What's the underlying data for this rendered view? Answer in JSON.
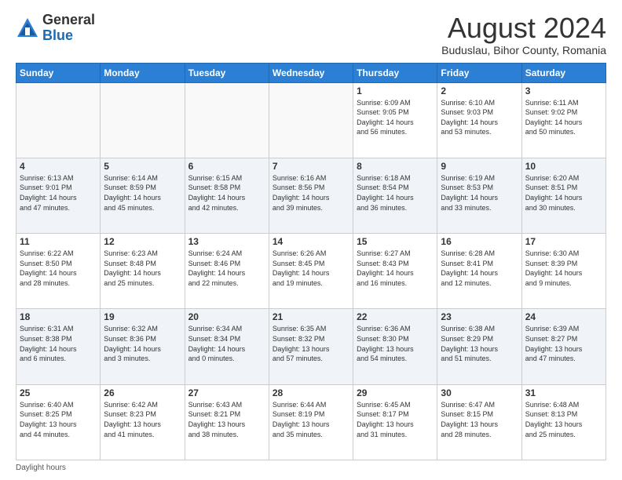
{
  "header": {
    "logo_general": "General",
    "logo_blue": "Blue",
    "main_title": "August 2024",
    "subtitle": "Buduslau, Bihor County, Romania"
  },
  "weekdays": [
    "Sunday",
    "Monday",
    "Tuesday",
    "Wednesday",
    "Thursday",
    "Friday",
    "Saturday"
  ],
  "weeks": [
    [
      {
        "day": "",
        "info": ""
      },
      {
        "day": "",
        "info": ""
      },
      {
        "day": "",
        "info": ""
      },
      {
        "day": "",
        "info": ""
      },
      {
        "day": "1",
        "info": "Sunrise: 6:09 AM\nSunset: 9:05 PM\nDaylight: 14 hours\nand 56 minutes."
      },
      {
        "day": "2",
        "info": "Sunrise: 6:10 AM\nSunset: 9:03 PM\nDaylight: 14 hours\nand 53 minutes."
      },
      {
        "day": "3",
        "info": "Sunrise: 6:11 AM\nSunset: 9:02 PM\nDaylight: 14 hours\nand 50 minutes."
      }
    ],
    [
      {
        "day": "4",
        "info": "Sunrise: 6:13 AM\nSunset: 9:01 PM\nDaylight: 14 hours\nand 47 minutes."
      },
      {
        "day": "5",
        "info": "Sunrise: 6:14 AM\nSunset: 8:59 PM\nDaylight: 14 hours\nand 45 minutes."
      },
      {
        "day": "6",
        "info": "Sunrise: 6:15 AM\nSunset: 8:58 PM\nDaylight: 14 hours\nand 42 minutes."
      },
      {
        "day": "7",
        "info": "Sunrise: 6:16 AM\nSunset: 8:56 PM\nDaylight: 14 hours\nand 39 minutes."
      },
      {
        "day": "8",
        "info": "Sunrise: 6:18 AM\nSunset: 8:54 PM\nDaylight: 14 hours\nand 36 minutes."
      },
      {
        "day": "9",
        "info": "Sunrise: 6:19 AM\nSunset: 8:53 PM\nDaylight: 14 hours\nand 33 minutes."
      },
      {
        "day": "10",
        "info": "Sunrise: 6:20 AM\nSunset: 8:51 PM\nDaylight: 14 hours\nand 30 minutes."
      }
    ],
    [
      {
        "day": "11",
        "info": "Sunrise: 6:22 AM\nSunset: 8:50 PM\nDaylight: 14 hours\nand 28 minutes."
      },
      {
        "day": "12",
        "info": "Sunrise: 6:23 AM\nSunset: 8:48 PM\nDaylight: 14 hours\nand 25 minutes."
      },
      {
        "day": "13",
        "info": "Sunrise: 6:24 AM\nSunset: 8:46 PM\nDaylight: 14 hours\nand 22 minutes."
      },
      {
        "day": "14",
        "info": "Sunrise: 6:26 AM\nSunset: 8:45 PM\nDaylight: 14 hours\nand 19 minutes."
      },
      {
        "day": "15",
        "info": "Sunrise: 6:27 AM\nSunset: 8:43 PM\nDaylight: 14 hours\nand 16 minutes."
      },
      {
        "day": "16",
        "info": "Sunrise: 6:28 AM\nSunset: 8:41 PM\nDaylight: 14 hours\nand 12 minutes."
      },
      {
        "day": "17",
        "info": "Sunrise: 6:30 AM\nSunset: 8:39 PM\nDaylight: 14 hours\nand 9 minutes."
      }
    ],
    [
      {
        "day": "18",
        "info": "Sunrise: 6:31 AM\nSunset: 8:38 PM\nDaylight: 14 hours\nand 6 minutes."
      },
      {
        "day": "19",
        "info": "Sunrise: 6:32 AM\nSunset: 8:36 PM\nDaylight: 14 hours\nand 3 minutes."
      },
      {
        "day": "20",
        "info": "Sunrise: 6:34 AM\nSunset: 8:34 PM\nDaylight: 14 hours\nand 0 minutes."
      },
      {
        "day": "21",
        "info": "Sunrise: 6:35 AM\nSunset: 8:32 PM\nDaylight: 13 hours\nand 57 minutes."
      },
      {
        "day": "22",
        "info": "Sunrise: 6:36 AM\nSunset: 8:30 PM\nDaylight: 13 hours\nand 54 minutes."
      },
      {
        "day": "23",
        "info": "Sunrise: 6:38 AM\nSunset: 8:29 PM\nDaylight: 13 hours\nand 51 minutes."
      },
      {
        "day": "24",
        "info": "Sunrise: 6:39 AM\nSunset: 8:27 PM\nDaylight: 13 hours\nand 47 minutes."
      }
    ],
    [
      {
        "day": "25",
        "info": "Sunrise: 6:40 AM\nSunset: 8:25 PM\nDaylight: 13 hours\nand 44 minutes."
      },
      {
        "day": "26",
        "info": "Sunrise: 6:42 AM\nSunset: 8:23 PM\nDaylight: 13 hours\nand 41 minutes."
      },
      {
        "day": "27",
        "info": "Sunrise: 6:43 AM\nSunset: 8:21 PM\nDaylight: 13 hours\nand 38 minutes."
      },
      {
        "day": "28",
        "info": "Sunrise: 6:44 AM\nSunset: 8:19 PM\nDaylight: 13 hours\nand 35 minutes."
      },
      {
        "day": "29",
        "info": "Sunrise: 6:45 AM\nSunset: 8:17 PM\nDaylight: 13 hours\nand 31 minutes."
      },
      {
        "day": "30",
        "info": "Sunrise: 6:47 AM\nSunset: 8:15 PM\nDaylight: 13 hours\nand 28 minutes."
      },
      {
        "day": "31",
        "info": "Sunrise: 6:48 AM\nSunset: 8:13 PM\nDaylight: 13 hours\nand 25 minutes."
      }
    ]
  ],
  "footer": {
    "daylight_hours": "Daylight hours"
  }
}
